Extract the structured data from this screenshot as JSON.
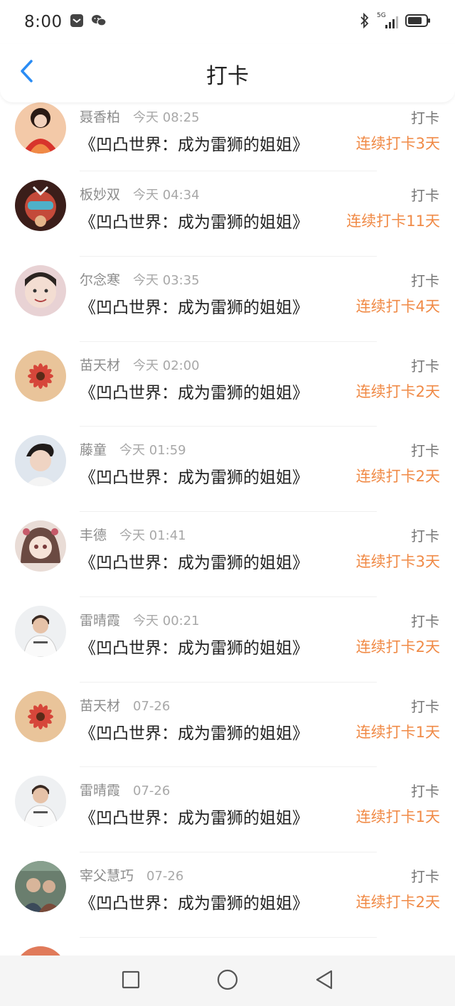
{
  "status_bar": {
    "time": "8:00",
    "network": "5G",
    "icons": [
      "notification-square-icon",
      "wechat-icon",
      "bluetooth-icon",
      "signal-icon",
      "battery-icon"
    ]
  },
  "header": {
    "title": "打卡",
    "back_icon": "chevron-left-icon",
    "accent_color": "#2a8cf4"
  },
  "colors": {
    "streak": "#f08a46",
    "name": "#8c8c8c",
    "title": "#222222"
  },
  "rows": [
    {
      "name": "聂香柏",
      "time": "今天 08:25",
      "book": "《凹凸世界：成为雷狮的姐姐》",
      "action": "打卡",
      "streak": "连续打卡3天",
      "avatar": "avatar-girl-red-dress"
    },
    {
      "name": "板妙双",
      "time": "今天 04:34",
      "book": "《凹凸世界：成为雷狮的姐姐》",
      "action": "打卡",
      "streak": "连续打卡11天",
      "avatar": "avatar-anime-masked"
    },
    {
      "name": "尔念寒",
      "time": "今天 03:35",
      "book": "《凹凸世界：成为雷狮的姐姐》",
      "action": "打卡",
      "streak": "连续打卡4天",
      "avatar": "avatar-smiling-person"
    },
    {
      "name": "苗天材",
      "time": "今天 02:00",
      "book": "《凹凸世界：成为雷狮的姐姐》",
      "action": "打卡",
      "streak": "连续打卡2天",
      "avatar": "avatar-red-flower"
    },
    {
      "name": "藤童",
      "time": "今天 01:59",
      "book": "《凹凸世界：成为雷狮的姐姐》",
      "action": "打卡",
      "streak": "连续打卡2天",
      "avatar": "avatar-young-man"
    },
    {
      "name": "丰德",
      "time": "今天 01:41",
      "book": "《凹凸世界：成为雷狮的姐姐》",
      "action": "打卡",
      "streak": "连续打卡3天",
      "avatar": "avatar-anime-girl"
    },
    {
      "name": "雷晴霞",
      "time": "今天 00:21",
      "book": "《凹凸世界：成为雷狮的姐姐》",
      "action": "打卡",
      "streak": "连续打卡2天",
      "avatar": "avatar-man-white-shirt"
    },
    {
      "name": "苗天材",
      "time": "07-26",
      "book": "《凹凸世界：成为雷狮的姐姐》",
      "action": "打卡",
      "streak": "连续打卡1天",
      "avatar": "avatar-red-flower"
    },
    {
      "name": "雷晴霞",
      "time": "07-26",
      "book": "《凹凸世界：成为雷狮的姐姐》",
      "action": "打卡",
      "streak": "连续打卡1天",
      "avatar": "avatar-man-white-shirt"
    },
    {
      "name": "宰父慧巧",
      "time": "07-26",
      "book": "《凹凸世界：成为雷狮的姐姐》",
      "action": "打卡",
      "streak": "连续打卡2天",
      "avatar": "avatar-group-photo"
    }
  ],
  "nav_bar": {
    "buttons": [
      "recent-apps-square-icon",
      "home-circle-icon",
      "back-triangle-icon"
    ]
  }
}
